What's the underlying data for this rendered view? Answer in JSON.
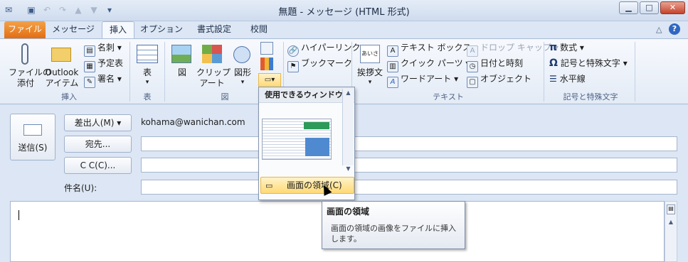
{
  "window": {
    "title": "無題 - メッセージ (HTML 形式)",
    "controls": {
      "minimize": "▁",
      "maximize": "□",
      "close": "✕"
    }
  },
  "tabs": [
    {
      "label": "ファイル"
    },
    {
      "label": "メッセージ"
    },
    {
      "label": "挿入"
    },
    {
      "label": "オプション"
    },
    {
      "label": "書式設定"
    },
    {
      "label": "校閲"
    }
  ],
  "active_tab": "挿入",
  "ribbon": {
    "insert_group": {
      "label": "挿入",
      "attach_file": "ファイルの\n添付",
      "outlook_item": "Outlook\nアイテム",
      "business_card": "名刺",
      "calendar": "予定表",
      "signature": "署名"
    },
    "table_group": {
      "label": "表",
      "table": "表"
    },
    "illustrations_group": {
      "label": "図",
      "picture": "図",
      "clipart": "クリップ\nアート",
      "shapes": "図形"
    },
    "links": {
      "hyperlink": "ハイパーリンク",
      "bookmark": "ブックマーク"
    },
    "text_group": {
      "label": "テキスト",
      "greeting": "挨拶文",
      "text_box": "テキスト ボックス",
      "quick_parts": "クイック パーツ",
      "wordart": "ワードアート",
      "drop_cap": "ドロップ キャップ",
      "date_time": "日付と時刻",
      "object": "オブジェクト"
    },
    "symbols_group": {
      "label": "記号と特殊文字",
      "equation": "数式",
      "symbol": "記号と特殊文字",
      "horizontal_line": "水平線"
    }
  },
  "compose": {
    "send": "送信(S)",
    "from_button": "差出人(M)",
    "from_value": "kohama@wanichan.com",
    "to_button": "宛先...",
    "cc_button": "C C(C)...",
    "subject_label": "件名(U):",
    "to_value": "",
    "cc_value": "",
    "subject_value": ""
  },
  "screenshot_dropdown": {
    "header": "使用できるウィンドウ",
    "item": "画面の領域(C)"
  },
  "tooltip": {
    "title": "画面の領域",
    "description": "画面の領域の画像をファイルに挿入します。"
  }
}
